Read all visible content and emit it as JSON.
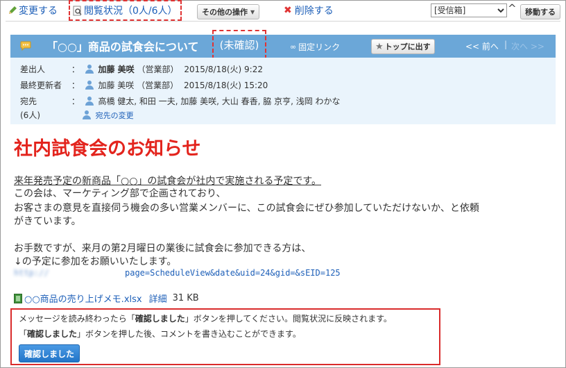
{
  "toolbar": {
    "edit": "変更する",
    "read_status": "閲覧状況（0人/6人）",
    "other_actions": "その他の操作",
    "delete": "削除する",
    "folder_selected": "[受信箱]",
    "move": "移動する"
  },
  "message": {
    "title": "「○○」商品の試食会について",
    "status": "(未確認)",
    "permalink": "固定リンク",
    "top_button": "トップに出す",
    "prev": "<< 前へ",
    "divider": "|",
    "next": "次へ >>"
  },
  "meta": {
    "sender_label": "差出人",
    "colon": "：",
    "sender_name": "加藤 美咲",
    "sender_dept": "（営業部）",
    "sent_at": "2015/8/18(火) 9:22",
    "updated_label": "最終更新者",
    "updater_name": "加藤 美咲",
    "updater_dept": "（営業部）",
    "updated_at": "2015/8/18(火) 15:20",
    "to_label": "宛先",
    "to_count": "(6人)",
    "recipients": "高橋 健太, 和田 一夫, 加藤 美咲, 大山 春香, 脇 京亨, 浅岡 わかな",
    "change_recipients": "宛先の変更"
  },
  "body": {
    "headline": "社内試食会のお知らせ",
    "line1": "来年発売予定の新商品「○○」の試食会が社内で実施される予定です。",
    "line2": "この会は、マーケティング部で企画されており、",
    "line3": "お客さまの意見を直接伺う機会の多い営業メンバーに、この試食会にぜひ参加していただけないか、と依頼",
    "line4": "がきています。",
    "line5": "お手数ですが、来月の第2月曜日の業後に試食会に参加できる方は、",
    "line6": "↓の予定に参加をお願いいたします。",
    "link_prefix": "http://",
    "link": "page=ScheduleView&date&uid=24&gid=&sEID=125",
    "attachment_name": "○○商品の売り上げメモ.xlsx",
    "attachment_detail": "詳細",
    "attachment_size": "31 KB"
  },
  "confirm": {
    "pre1": "メッセージを読み終わったら「",
    "bold1": "確認しました",
    "post1": "」ボタンを押してください。閲覧状況に反映されます。",
    "pre2": "「",
    "bold2": "確認しました",
    "post2": "」ボタンを押した後、コメントを書き込むことができます。",
    "button": "確認しました"
  },
  "colors": {
    "accent_blue": "#6ba7d8",
    "headline_red": "#e3241d",
    "highlight_red": "#e03333",
    "meta_bg": "#eaf4fc",
    "button_blue": "#2a7ccc"
  }
}
